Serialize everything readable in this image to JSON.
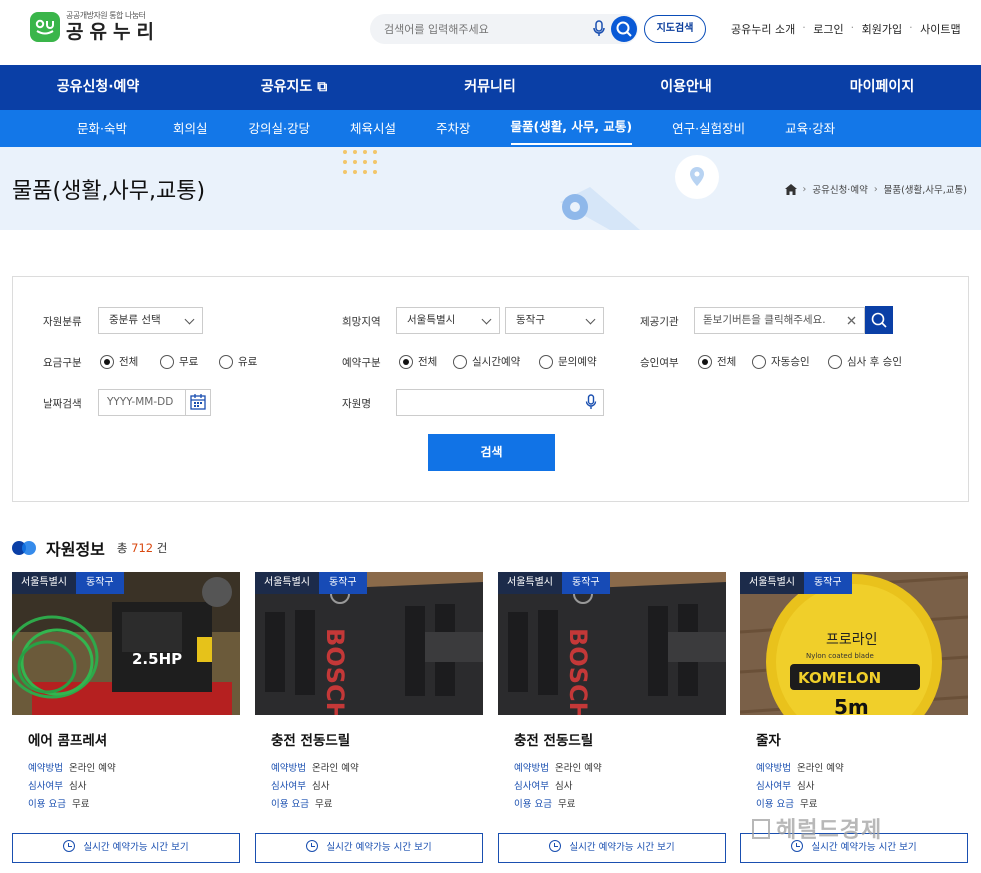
{
  "header": {
    "logo_sub": "공공개방자원 통합 나눔터",
    "logo_main": "공유누리",
    "logo_mark": "아Ц",
    "search_placeholder": "검색어를 입력해주세요",
    "map_search": "지도검색",
    "util": [
      "공유누리 소개",
      "로그인",
      "회원가입",
      "사이트맵"
    ]
  },
  "gnb": [
    "공유신청·예약",
    "공유지도 ⧉",
    "커뮤니티",
    "이용안내",
    "마이페이지"
  ],
  "lnb": [
    "문화·숙박",
    "회의실",
    "강의실·강당",
    "체육시설",
    "주차장",
    "물품(생활, 사무, 교통)",
    "연구·실험장비",
    "교육·강좌"
  ],
  "lnb_active": 5,
  "page": {
    "title": "물품(생활,사무,교통)",
    "breadcrumb": [
      "공유신청·예약",
      "물품(생활,사무,교통)"
    ]
  },
  "filter": {
    "category_label": "자원분류",
    "category_value": "중분류 선택",
    "region_label": "희망지역",
    "region_city": "서울특별시",
    "region_district": "동작구",
    "org_label": "제공기관",
    "org_placeholder": "돋보기버튼을 클릭해주세요.",
    "fee_label": "요금구분",
    "fee_options": [
      "전체",
      "무료",
      "유료"
    ],
    "reserve_label": "예약구분",
    "reserve_options": [
      "전체",
      "실시간예약",
      "문의예약"
    ],
    "approve_label": "승인여부",
    "approve_options": [
      "전체",
      "자동승인",
      "심사 후 승인"
    ],
    "date_label": "날짜검색",
    "date_placeholder": "YYYY-MM-DD",
    "name_label": "자원명",
    "search_button": "검색"
  },
  "results": {
    "title": "자원정보",
    "count_prefix": "총",
    "count": "712",
    "count_suffix": "건"
  },
  "cards": [
    {
      "city": "서울특별시",
      "district": "동작구",
      "name": "에어 콤프레셔",
      "method_label": "예약방법",
      "method": "온라인 예약",
      "review_label": "심사여부",
      "review": "심사",
      "fee_label": "이용 요금",
      "fee": "무료",
      "button": "실시간 예약가능 시간 보기",
      "image_text": "2.5HP"
    },
    {
      "city": "서울특별시",
      "district": "동작구",
      "name": "충전 전동드릴",
      "method_label": "예약방법",
      "method": "온라인 예약",
      "review_label": "심사여부",
      "review": "심사",
      "fee_label": "이용 요금",
      "fee": "무료",
      "button": "실시간 예약가능 시간 보기",
      "image_text": "BOSCH"
    },
    {
      "city": "서울특별시",
      "district": "동작구",
      "name": "충전 전동드릴",
      "method_label": "예약방법",
      "method": "온라인 예약",
      "review_label": "심사여부",
      "review": "심사",
      "fee_label": "이용 요금",
      "fee": "무료",
      "button": "실시간 예약가능 시간 보기",
      "image_text": "BOSCH"
    },
    {
      "city": "서울특별시",
      "district": "동작구",
      "name": "줄자",
      "method_label": "예약방법",
      "method": "온라인 예약",
      "review_label": "심사여부",
      "review": "심사",
      "fee_label": "이용 요금",
      "fee": "무료",
      "button": "실시간 예약가능 시간 보기",
      "image_text": "KOMELON",
      "image_text2": "프로라인",
      "image_text3": "Nylon coated blade",
      "image_text4": "5m"
    }
  ],
  "watermark": "헤럴드경제",
  "colors": {
    "gnb": "#0a3fa6",
    "lnb": "#1377e8",
    "accent": "#1173e6",
    "count": "#d9480f"
  }
}
